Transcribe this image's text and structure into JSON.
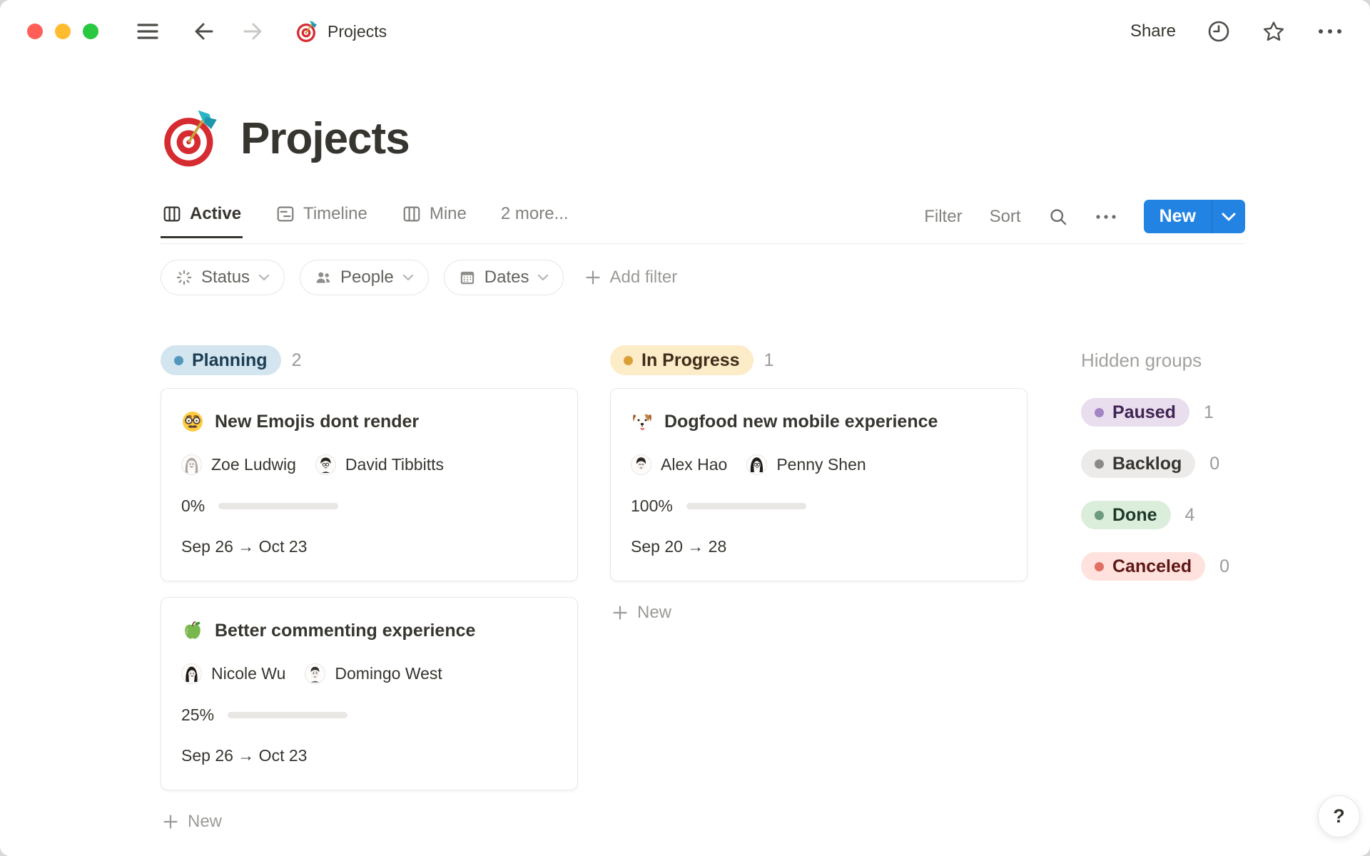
{
  "colors": {
    "accent_blue": "#2383E2",
    "progress_green": "#6C9B7D",
    "progress_track": "#E8E7E4",
    "text_primary": "#37352F",
    "text_secondary": "#9B9A97"
  },
  "topbar": {
    "breadcrumb": "Projects",
    "share": "Share"
  },
  "page": {
    "emoji": "🎯",
    "title": "Projects"
  },
  "tabs": [
    {
      "label": "Active"
    },
    {
      "label": "Timeline"
    },
    {
      "label": "Mine"
    },
    {
      "label": "2 more..."
    }
  ],
  "toolbar": {
    "filter": "Filter",
    "sort": "Sort",
    "new": "New"
  },
  "filter_bar": {
    "chips": [
      {
        "label": "Status"
      },
      {
        "label": "People"
      },
      {
        "label": "Dates"
      }
    ],
    "add_filter": "Add filter"
  },
  "board": {
    "groups": [
      {
        "name": "Planning",
        "count": "2",
        "colors": {
          "bg": "#D3E5EF",
          "dot": "#5496BD",
          "text": "#1D3D52"
        },
        "new_label": "New",
        "cards": [
          {
            "emoji": "🥸",
            "title": "New Emojis dont  render",
            "assignees": [
              "Zoe Ludwig",
              "David Tibbitts"
            ],
            "progress_label": "0%",
            "progress": 0,
            "dates": "Sep 26 → Oct 23"
          },
          {
            "emoji": "🍏",
            "title": "Better commenting experience",
            "assignees": [
              "Nicole Wu",
              "Domingo West"
            ],
            "progress_label": "25%",
            "progress": 25,
            "dates": "Sep 26 → Oct 23"
          }
        ]
      },
      {
        "name": "In Progress",
        "count": "1",
        "colors": {
          "bg": "#FDECC8",
          "dot": "#D9A037",
          "text": "#402C1B"
        },
        "new_label": "New",
        "cards": [
          {
            "emoji": "🐶",
            "title": "Dogfood new mobile experience",
            "assignees": [
              "Alex Hao",
              "Penny Shen"
            ],
            "progress_label": "100%",
            "progress": 100,
            "dates": "Sep 20 → 28"
          }
        ]
      }
    ],
    "hidden": {
      "title": "Hidden groups",
      "items": [
        {
          "name": "Paused",
          "count": "1",
          "colors": {
            "bg": "#E8DEEE",
            "dot": "#A584C6",
            "text": "#412454"
          }
        },
        {
          "name": "Backlog",
          "count": "0",
          "colors": {
            "bg": "#ECEBEA",
            "dot": "#8A8A87",
            "text": "#373530"
          }
        },
        {
          "name": "Done",
          "count": "4",
          "colors": {
            "bg": "#DBEDDB",
            "dot": "#6C9B7D",
            "text": "#1C3829"
          }
        },
        {
          "name": "Canceled",
          "count": "0",
          "colors": {
            "bg": "#FFE2DD",
            "dot": "#E16F64",
            "text": "#5D1715"
          }
        }
      ]
    }
  },
  "help": "?"
}
